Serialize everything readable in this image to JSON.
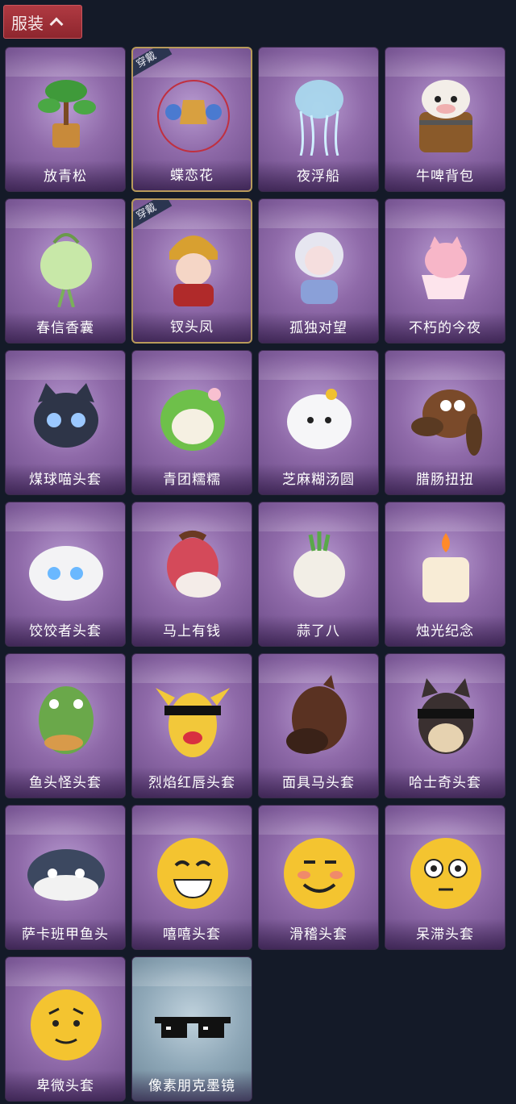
{
  "header": {
    "tab_label": "服装"
  },
  "items": [
    {
      "name": "放青松",
      "equipped": false,
      "theme": "purple",
      "icon": "bonsai-tree-icon"
    },
    {
      "name": "蝶恋花",
      "equipped": true,
      "theme": "purple",
      "icon": "butterfly-bell-ornament-icon"
    },
    {
      "name": "夜浮船",
      "equipped": false,
      "theme": "purple",
      "icon": "jellyfish-icon"
    },
    {
      "name": "牛啤背包",
      "equipped": false,
      "theme": "purple",
      "icon": "cow-beer-barrel-icon"
    },
    {
      "name": "春信香囊",
      "equipped": false,
      "theme": "purple",
      "icon": "scent-pouch-icon"
    },
    {
      "name": "钗头凤",
      "equipped": true,
      "theme": "purple",
      "icon": "phoenix-crown-doll-icon"
    },
    {
      "name": "孤独对望",
      "equipped": false,
      "theme": "purple",
      "icon": "lonely-gaze-doll-icon"
    },
    {
      "name": "不朽的今夜",
      "equipped": false,
      "theme": "purple",
      "icon": "fox-in-cup-icon"
    },
    {
      "name": "煤球喵头套",
      "equipped": false,
      "theme": "purple",
      "icon": "black-cat-head-icon"
    },
    {
      "name": "青团糯糯",
      "equipped": false,
      "theme": "purple",
      "icon": "green-dumpling-icon"
    },
    {
      "name": "芝麻糊汤圆",
      "equipped": false,
      "theme": "purple",
      "icon": "rice-ball-icon"
    },
    {
      "name": "腊肠扭扭",
      "equipped": false,
      "theme": "purple",
      "icon": "dachshund-head-icon"
    },
    {
      "name": "饺饺者头套",
      "equipped": false,
      "theme": "purple",
      "icon": "dumpling-head-icon"
    },
    {
      "name": "马上有钱",
      "equipped": false,
      "theme": "purple",
      "icon": "red-horse-head-icon"
    },
    {
      "name": "蒜了八",
      "equipped": false,
      "theme": "purple",
      "icon": "garlic-head-icon"
    },
    {
      "name": "烛光纪念",
      "equipped": false,
      "theme": "purple",
      "icon": "candle-head-icon"
    },
    {
      "name": "鱼头怪头套",
      "equipped": false,
      "theme": "purple",
      "icon": "fish-head-icon"
    },
    {
      "name": "烈焰红唇头套",
      "equipped": false,
      "theme": "purple",
      "icon": "yellow-mouse-head-icon"
    },
    {
      "name": "面具马头套",
      "equipped": false,
      "theme": "purple",
      "icon": "horse-mask-icon"
    },
    {
      "name": "哈士奇头套",
      "equipped": false,
      "theme": "purple",
      "icon": "husky-head-icon"
    },
    {
      "name": "萨卡班甲鱼头",
      "equipped": false,
      "theme": "purple",
      "icon": "sacabambaspis-head-icon"
    },
    {
      "name": "嘻嘻头套",
      "equipped": false,
      "theme": "purple",
      "icon": "grin-emoji-head-icon"
    },
    {
      "name": "滑稽头套",
      "equipped": false,
      "theme": "purple",
      "icon": "funny-emoji-head-icon"
    },
    {
      "name": "呆滞头套",
      "equipped": false,
      "theme": "purple",
      "icon": "dazed-emoji-head-icon"
    },
    {
      "name": "卑微头套",
      "equipped": false,
      "theme": "purple",
      "icon": "humble-emoji-head-icon"
    },
    {
      "name": "像素朋克墨镜",
      "equipped": false,
      "theme": "blue",
      "icon": "pixel-sunglasses-icon"
    }
  ],
  "equipped_badge_label": "穿戴",
  "colors": {
    "tab_bg": "#a8323a",
    "card_purple": "#8f6aa9",
    "card_blue": "#8fa8b8",
    "equipped_border": "#b89a5a",
    "page_bg": "#141a28"
  }
}
